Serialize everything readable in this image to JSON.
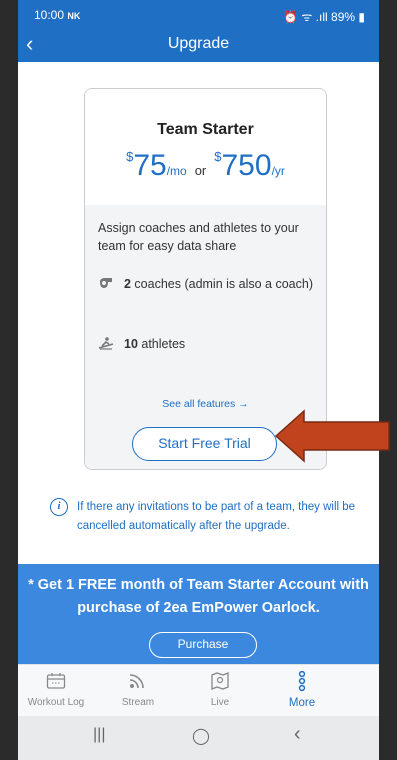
{
  "status": {
    "time": "10:00",
    "carrier": "NK",
    "indicators": "⏰ ᯤ .ıll 89% ▮"
  },
  "appbar": {
    "back": "‹",
    "title": "Upgrade"
  },
  "plan": {
    "name": "Team Starter",
    "price_month_currency": "$",
    "price_month": "75",
    "price_month_unit": "/mo",
    "or": "or",
    "price_year_currency": "$",
    "price_year": "750",
    "price_year_unit": "/yr",
    "description": "Assign coaches and athletes to your team for easy data share",
    "features": [
      {
        "icon": "whistle-icon",
        "bold": "2",
        "text": " coaches (admin is also a coach)"
      },
      {
        "icon": "rower-icon",
        "bold": "10",
        "text": " athletes"
      }
    ],
    "see_all": "See all features →",
    "trial_button": "Start Free Trial"
  },
  "notice": {
    "text": "If there any invitations to be part of a team, they will be cancelled automatically after the upgrade."
  },
  "promo": {
    "text": "* Get 1 FREE month of Team Starter Account with purchase of 2ea EmPower Oarlock.",
    "button": "Purchase"
  },
  "tabs": [
    {
      "label": "Workout Log",
      "icon": "calendar-icon",
      "active": false
    },
    {
      "label": "Stream",
      "icon": "rss-icon",
      "active": false
    },
    {
      "label": "Live",
      "icon": "map-icon",
      "active": false
    },
    {
      "label": "More",
      "icon": "more-icon",
      "active": true
    }
  ],
  "navbar": {
    "recents": "|||",
    "home": "◯",
    "back": "‹"
  },
  "colors": {
    "primary": "#1f6fc5",
    "promo": "#3b88de",
    "arrow": "#c0431e"
  }
}
